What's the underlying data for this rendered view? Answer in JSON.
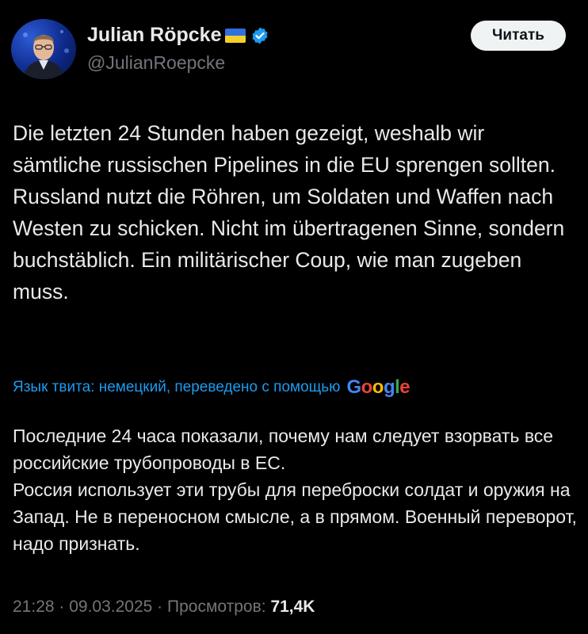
{
  "author": {
    "display_name": "Julian Röpcke",
    "handle": "@JulianRoepcke",
    "flag_icon": "ukraine-flag-icon",
    "verified_icon": "verified-badge-icon",
    "verified_color": "#1d9bf0"
  },
  "header": {
    "follow_label": "Читать"
  },
  "tweet": {
    "lines": [
      "Die letzten 24 Stunden haben gezeigt, weshalb wir sämtliche russischen Pipelines in die EU sprengen sollten.",
      "Russland nutzt die Röhren, um Soldaten und Waffen nach Westen zu schicken. Nicht im übertragenen Sinne, sondern buchstäblich. Ein militärischer Coup, wie man zugeben muss."
    ]
  },
  "translation": {
    "note": "Язык твита: немецкий, переведено с помощью",
    "provider_letters": [
      "G",
      "o",
      "o",
      "g",
      "l",
      "e"
    ],
    "provider_colors": [
      "#4285f4",
      "#ea4335",
      "#fbbc05",
      "#4285f4",
      "#34a853",
      "#ea4335"
    ],
    "lines": [
      "Последние 24 часа показали, почему нам следует взорвать все российские трубопроводы в ЕС.",
      "Россия использует эти трубы для переброски солдат и оружия на Запад. Не в переносном смысле, а в прямом. Военный переворот, надо признать."
    ]
  },
  "meta": {
    "time": "21:28",
    "separator": " · ",
    "date": "09.03.2025",
    "views_label": "Просмотров:",
    "views_count": "71,4K"
  },
  "colors": {
    "background": "#000000",
    "text": "#e7e9ea",
    "secondary": "#71767b",
    "link": "#1d9bf0"
  }
}
